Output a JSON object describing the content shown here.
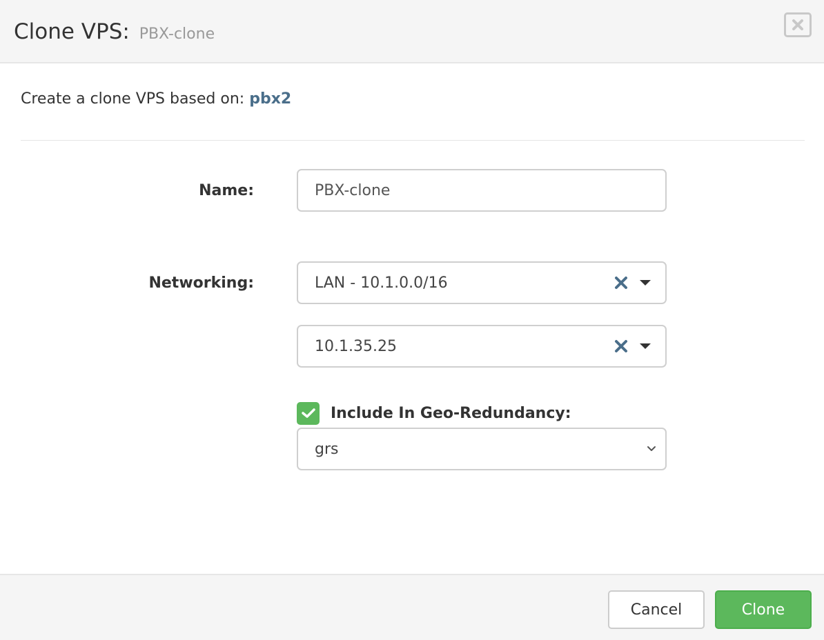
{
  "header": {
    "title": "Clone VPS:",
    "subtitle": "PBX-clone"
  },
  "intro": {
    "text": "Create a clone VPS based on:",
    "source_name": "pbx2"
  },
  "form": {
    "name": {
      "label": "Name:",
      "value": "PBX-clone"
    },
    "networking": {
      "label": "Networking:",
      "network_value": "LAN - 10.1.0.0/16",
      "ip_value": "10.1.35.25"
    },
    "geo_redundancy": {
      "label": "Include In Geo-Redundancy:",
      "checked": true,
      "selected": "grs"
    }
  },
  "footer": {
    "cancel_label": "Cancel",
    "clone_label": "Clone"
  },
  "colors": {
    "accent_green": "#5cb85c",
    "link_blue": "#4a6e8a",
    "clear_icon": "#4a6e8a"
  },
  "icons": {
    "close": "close-icon",
    "clear": "clear-icon",
    "caret": "caret-down-icon",
    "chevron": "chevron-down-icon",
    "check": "check-icon"
  }
}
